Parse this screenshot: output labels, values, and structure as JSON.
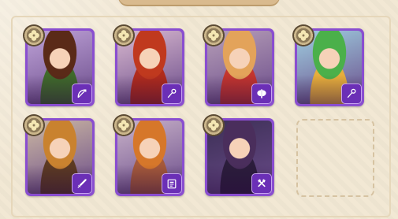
{
  "panel": {
    "title": ""
  },
  "heroes": [
    {
      "id": "hero-1",
      "rank_icon": "clover-icon",
      "class_icon": "bow-icon",
      "hair": "#5a2a18",
      "bg": "#bfa3d8",
      "outfit": "#3f6a2a"
    },
    {
      "id": "hero-2",
      "rank_icon": "clover-icon",
      "class_icon": "magic-staff-icon",
      "hair": "#c0391e",
      "bg": "#d9b9cf",
      "outfit": "#b02b1c"
    },
    {
      "id": "hero-3",
      "rank_icon": "clover-icon",
      "class_icon": "axe-icon",
      "hair": "#e3a35a",
      "bg": "#b79fb8",
      "outfit": "#c3352e"
    },
    {
      "id": "hero-4",
      "rank_icon": "clover-icon",
      "class_icon": "magic-staff-icon",
      "hair": "#4bb04a",
      "bg": "#9fcfe0",
      "outfit": "#e7ae3b"
    },
    {
      "id": "hero-5",
      "rank_icon": "clover-icon",
      "class_icon": "sword-icon",
      "hair": "#c9822f",
      "bg": "#cdb9a2",
      "outfit": "#5c3a22"
    },
    {
      "id": "hero-6",
      "rank_icon": "clover-icon",
      "class_icon": "spellbook-icon",
      "hair": "#d6772a",
      "bg": "#c9b3c9",
      "outfit": "#a5593a"
    },
    {
      "id": "hero-7",
      "rank_icon": "clover-icon",
      "class_icon": "crossed-hammers-icon",
      "hair": "#4a2e5c",
      "bg": "#3c2f55",
      "outfit": "#2b1d3b"
    }
  ],
  "empty_slot": {
    "visible": true
  }
}
